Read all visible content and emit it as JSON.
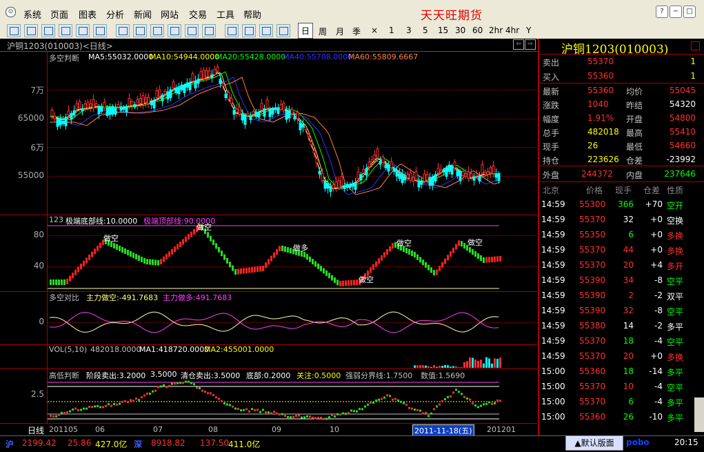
{
  "app": {
    "brand": "天天旺期货"
  },
  "menu": [
    "系统",
    "页面",
    "图表",
    "分析",
    "新闻",
    "网站",
    "交易",
    "工具",
    "帮助"
  ],
  "window_buttons": [
    "?",
    "−",
    "□",
    "×"
  ],
  "toolbar": {
    "periods": [
      "日",
      "周",
      "月",
      "季",
      "×",
      "1",
      "3",
      "5",
      "15",
      "30",
      "60",
      "2hr",
      "4hr",
      "Y"
    ],
    "active": "日"
  },
  "chart": {
    "title": "沪铜1203(010003)<日线>",
    "main": {
      "indicator": "多空判断",
      "ma": [
        {
          "label": "MA5:55032.0000",
          "color": "#ffffff"
        },
        {
          "label": "MA10:54944.0000",
          "color": "#ffff00"
        },
        {
          "label": "MA20:55428.0000",
          "color": "#00ff00"
        },
        {
          "label": "MA40:55708.0000",
          "color": "#3030ff"
        },
        {
          "label": "MA60:55809.6667",
          "color": "#ff8040"
        }
      ],
      "yticks": [
        "7万",
        "65000",
        "6万",
        "55000"
      ]
    },
    "osc": {
      "label": "123",
      "l1": "极端底部线:10.0000",
      "l2": "极端顶部线:90.0000",
      "yticks": [
        "80",
        "40"
      ],
      "signal_up": "做多",
      "signal_down": "做空"
    },
    "ratio": {
      "label": "多空对比",
      "l1": "主力做空:-491.7683",
      "l2": "主力做多:491.7683",
      "yticks": [
        "0"
      ]
    },
    "vol": {
      "label": "VOL(5,10)",
      "v": "482018.0000",
      "ma1": "MA1:418720.0000",
      "ma2": "MA2:455001.0000"
    },
    "hl": {
      "label": "高低判断",
      "parts": [
        "阶段卖出:3.2000",
        "3.5000",
        "清仓卖出:3.5000",
        "底部:0.2000",
        "关注:0.5000",
        "强弱分界线:1.7500",
        "数值:1.5690"
      ],
      "yticks": [
        "2.5"
      ]
    },
    "xaxis": {
      "mode": "日线",
      "labels": [
        "201105",
        "06",
        "07",
        "08",
        "09",
        "10",
        "2011-11-18(五)",
        "201201"
      ]
    }
  },
  "quote": {
    "name": "沪铜1203(010003)",
    "sell": {
      "label": "卖出",
      "price": "55370",
      "vol": "1"
    },
    "buy": {
      "label": "买入",
      "price": "55360",
      "vol": "1"
    },
    "stats": [
      {
        "l1": "最新",
        "v1": "55360",
        "c1": "#ff3030",
        "l2": "均价",
        "v2": "55045",
        "c2": "#ff3030"
      },
      {
        "l1": "涨跌",
        "v1": "1040",
        "c1": "#ff3030",
        "l2": "昨结",
        "v2": "54320",
        "c2": "#ffffff"
      },
      {
        "l1": "幅度",
        "v1": "1.91%",
        "c1": "#ff3030",
        "l2": "开盘",
        "v2": "54800",
        "c2": "#ff3030"
      },
      {
        "l1": "总手",
        "v1": "482018",
        "c1": "#ffff00",
        "l2": "最高",
        "v2": "55410",
        "c2": "#ff3030"
      },
      {
        "l1": "现手",
        "v1": "26",
        "c1": "#ffff00",
        "l2": "最低",
        "v2": "54660",
        "c2": "#ff3030"
      },
      {
        "l1": "持仓",
        "v1": "223626",
        "c1": "#ffff00",
        "l2": "仓差",
        "v2": "-23992",
        "c2": "#ffffff"
      }
    ],
    "outer": {
      "label": "外盘",
      "value": "244372"
    },
    "inner": {
      "label": "内盘",
      "value": "237646"
    },
    "ticks_header": [
      "北京",
      "价格",
      "现手",
      "仓差",
      "性质"
    ],
    "ticks": [
      {
        "t": "14:59",
        "p": "55300",
        "v": "366",
        "d": "+70",
        "n": "空开",
        "vc": "#00ff00",
        "nc": "#00ff00"
      },
      {
        "t": "14:59",
        "p": "55370",
        "v": "32",
        "d": "+0",
        "n": "空换",
        "vc": "#ffffff",
        "nc": "#ffffff"
      },
      {
        "t": "14:59",
        "p": "55350",
        "v": "6",
        "d": "+0",
        "n": "多换",
        "vc": "#00ff00",
        "nc": "#ff3030"
      },
      {
        "t": "14:59",
        "p": "55370",
        "v": "44",
        "d": "+0",
        "n": "多换",
        "vc": "#ff3030",
        "nc": "#ff3030"
      },
      {
        "t": "14:59",
        "p": "55370",
        "v": "20",
        "d": "+4",
        "n": "多开",
        "vc": "#ff3030",
        "nc": "#ff3030"
      },
      {
        "t": "14:59",
        "p": "55390",
        "v": "34",
        "d": "-8",
        "n": "空平",
        "vc": "#ff3030",
        "nc": "#00ff00"
      },
      {
        "t": "14:59",
        "p": "55390",
        "v": "2",
        "d": "-2",
        "n": "双平",
        "vc": "#ff3030",
        "nc": "#ffffff"
      },
      {
        "t": "14:59",
        "p": "55390",
        "v": "32",
        "d": "-8",
        "n": "空平",
        "vc": "#ff3030",
        "nc": "#00ff00"
      },
      {
        "t": "14:59",
        "p": "55380",
        "v": "14",
        "d": "-2",
        "n": "多平",
        "vc": "#ffffff",
        "nc": "#ffffff"
      },
      {
        "t": "14:59",
        "p": "55370",
        "v": "18",
        "d": "-4",
        "n": "空平",
        "vc": "#00ff00",
        "nc": "#00ff00"
      },
      {
        "t": "14:59",
        "p": "55370",
        "v": "20",
        "d": "+0",
        "n": "多换",
        "vc": "#ff3030",
        "nc": "#ff3030"
      },
      {
        "t": "15:00",
        "p": "55360",
        "v": "18",
        "d": "-14",
        "n": "多平",
        "vc": "#00ff00",
        "nc": "#00ff00"
      },
      {
        "t": "15:00",
        "p": "55370",
        "v": "10",
        "d": "-4",
        "n": "空平",
        "vc": "#ff3030",
        "nc": "#00ff00"
      },
      {
        "t": "15:00",
        "p": "55370",
        "v": "6",
        "d": "-4",
        "n": "多平",
        "vc": "#00ff00",
        "nc": "#00ff00"
      },
      {
        "t": "15:00",
        "p": "55360",
        "v": "26",
        "d": "-10",
        "n": "多平",
        "vc": "#00ff00",
        "nc": "#00ff00"
      }
    ]
  },
  "status": {
    "sh_label": "沪",
    "sh_idx": "2199.42",
    "sh_chg": "25.86",
    "sh_amt": "427.0亿",
    "sz_label": "深",
    "sz_idx": "8918.82",
    "sz_chg": "137.50",
    "sz_amt": "411.0亿",
    "layout_btn": "▲默认版面",
    "pobo": "pobo",
    "time": "20:15"
  }
}
